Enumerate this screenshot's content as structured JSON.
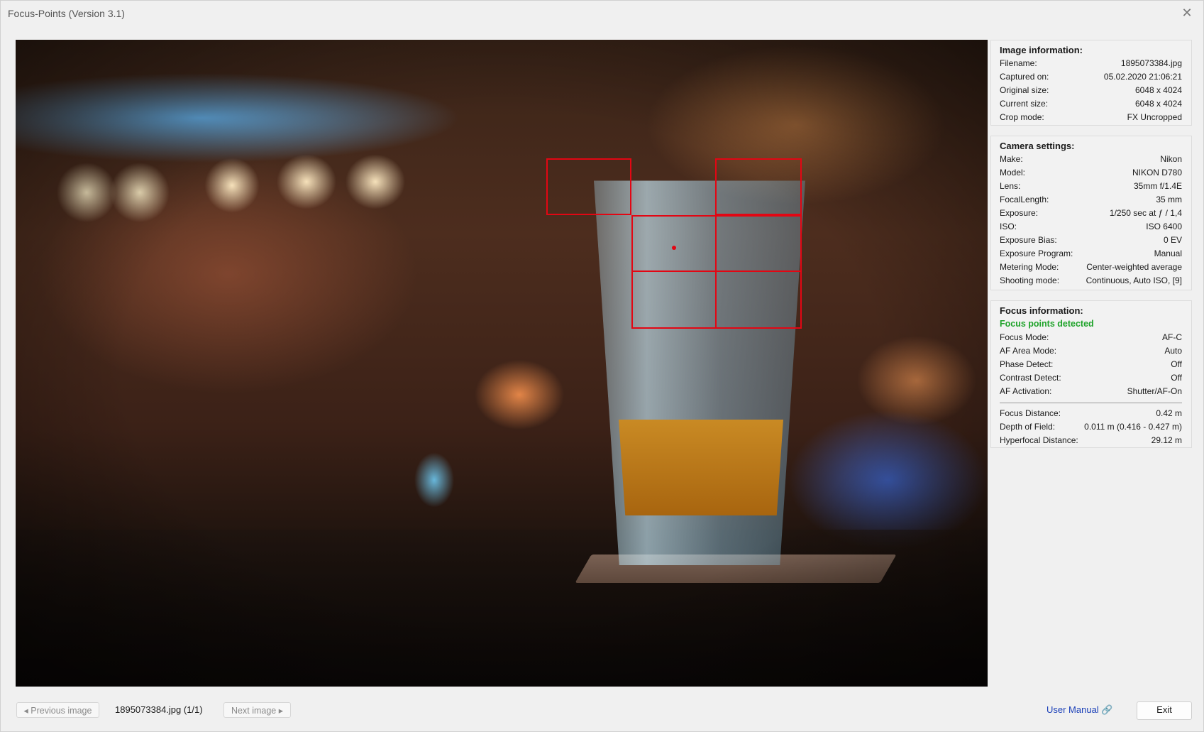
{
  "window": {
    "title": "Focus-Points (Version 3.1)",
    "close_glyph": "✕"
  },
  "image_info": {
    "title": "Image information:",
    "rows": [
      {
        "label": "Filename:",
        "value": "1895073384.jpg"
      },
      {
        "label": "Captured on:",
        "value": "05.02.2020 21:06:21"
      },
      {
        "label": "Original size:",
        "value": "6048 x 4024"
      },
      {
        "label": "Current size:",
        "value": "6048 x 4024"
      },
      {
        "label": "Crop mode:",
        "value": "FX Uncropped"
      }
    ]
  },
  "camera_settings": {
    "title": "Camera settings:",
    "rows": [
      {
        "label": "Make:",
        "value": "Nikon"
      },
      {
        "label": "Model:",
        "value": "NIKON D780"
      },
      {
        "label": "Lens:",
        "value": "35mm f/1.4E"
      },
      {
        "label": "FocalLength:",
        "value": "35 mm"
      },
      {
        "label": "Exposure:",
        "value": "1/250 sec at ƒ / 1,4"
      },
      {
        "label": "ISO:",
        "value": "ISO 6400"
      },
      {
        "label": "Exposure Bias:",
        "value": "0 EV"
      },
      {
        "label": "Exposure Program:",
        "value": "Manual"
      },
      {
        "label": "Metering Mode:",
        "value": "Center-weighted average"
      },
      {
        "label": "Shooting mode:",
        "value": "Continuous, Auto ISO, [9]"
      }
    ]
  },
  "focus_info": {
    "title": "Focus information:",
    "status": "Focus points detected",
    "rows": [
      {
        "label": "Focus Mode:",
        "value": "AF-C"
      },
      {
        "label": "AF Area Mode:",
        "value": "Auto"
      },
      {
        "label": "Phase Detect:",
        "value": "Off"
      },
      {
        "label": "Contrast Detect:",
        "value": "Off"
      },
      {
        "label": "AF Activation:",
        "value": "Shutter/AF-On"
      }
    ],
    "distance_rows": [
      {
        "label": "Focus Distance:",
        "value": "0.42 m"
      },
      {
        "label": "Depth of Field:",
        "value": "0.011 m (0.416 - 0.427 m)"
      },
      {
        "label": "Hyperfocal Distance:",
        "value": "29.12 m"
      }
    ]
  },
  "footer": {
    "previous_label": "◂ Previous image",
    "file_position": "1895073384.jpg (1/1)",
    "next_label": "Next image ▸",
    "manual_label": "User Manual 🔗",
    "exit_label": "Exit"
  },
  "colors": {
    "af_frame": "#e30613",
    "detected_text": "#1fa32a",
    "link": "#1a3fb8"
  }
}
